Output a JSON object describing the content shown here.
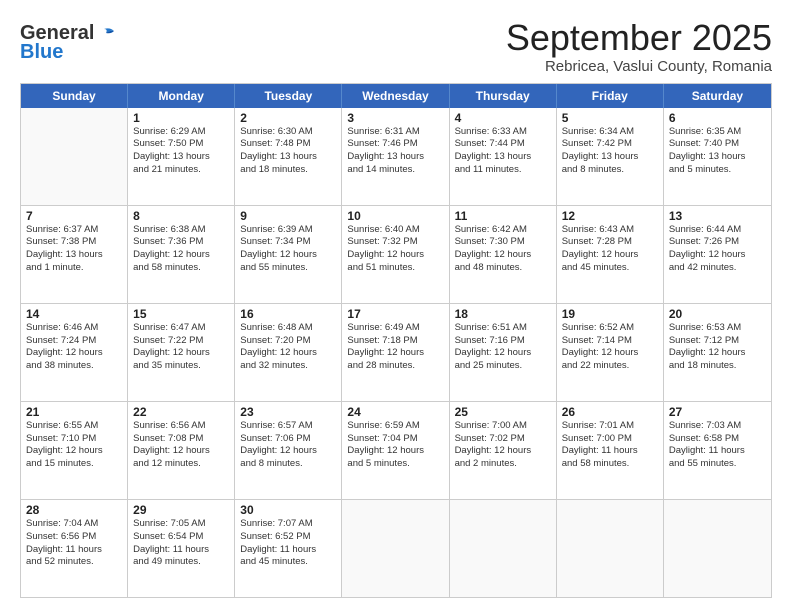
{
  "logo": {
    "general": "General",
    "blue": "Blue"
  },
  "title": "September 2025",
  "location": "Rebricea, Vaslui County, Romania",
  "header_days": [
    "Sunday",
    "Monday",
    "Tuesday",
    "Wednesday",
    "Thursday",
    "Friday",
    "Saturday"
  ],
  "rows": [
    [
      {
        "day": "",
        "lines": []
      },
      {
        "day": "1",
        "lines": [
          "Sunrise: 6:29 AM",
          "Sunset: 7:50 PM",
          "Daylight: 13 hours",
          "and 21 minutes."
        ]
      },
      {
        "day": "2",
        "lines": [
          "Sunrise: 6:30 AM",
          "Sunset: 7:48 PM",
          "Daylight: 13 hours",
          "and 18 minutes."
        ]
      },
      {
        "day": "3",
        "lines": [
          "Sunrise: 6:31 AM",
          "Sunset: 7:46 PM",
          "Daylight: 13 hours",
          "and 14 minutes."
        ]
      },
      {
        "day": "4",
        "lines": [
          "Sunrise: 6:33 AM",
          "Sunset: 7:44 PM",
          "Daylight: 13 hours",
          "and 11 minutes."
        ]
      },
      {
        "day": "5",
        "lines": [
          "Sunrise: 6:34 AM",
          "Sunset: 7:42 PM",
          "Daylight: 13 hours",
          "and 8 minutes."
        ]
      },
      {
        "day": "6",
        "lines": [
          "Sunrise: 6:35 AM",
          "Sunset: 7:40 PM",
          "Daylight: 13 hours",
          "and 5 minutes."
        ]
      }
    ],
    [
      {
        "day": "7",
        "lines": [
          "Sunrise: 6:37 AM",
          "Sunset: 7:38 PM",
          "Daylight: 13 hours",
          "and 1 minute."
        ]
      },
      {
        "day": "8",
        "lines": [
          "Sunrise: 6:38 AM",
          "Sunset: 7:36 PM",
          "Daylight: 12 hours",
          "and 58 minutes."
        ]
      },
      {
        "day": "9",
        "lines": [
          "Sunrise: 6:39 AM",
          "Sunset: 7:34 PM",
          "Daylight: 12 hours",
          "and 55 minutes."
        ]
      },
      {
        "day": "10",
        "lines": [
          "Sunrise: 6:40 AM",
          "Sunset: 7:32 PM",
          "Daylight: 12 hours",
          "and 51 minutes."
        ]
      },
      {
        "day": "11",
        "lines": [
          "Sunrise: 6:42 AM",
          "Sunset: 7:30 PM",
          "Daylight: 12 hours",
          "and 48 minutes."
        ]
      },
      {
        "day": "12",
        "lines": [
          "Sunrise: 6:43 AM",
          "Sunset: 7:28 PM",
          "Daylight: 12 hours",
          "and 45 minutes."
        ]
      },
      {
        "day": "13",
        "lines": [
          "Sunrise: 6:44 AM",
          "Sunset: 7:26 PM",
          "Daylight: 12 hours",
          "and 42 minutes."
        ]
      }
    ],
    [
      {
        "day": "14",
        "lines": [
          "Sunrise: 6:46 AM",
          "Sunset: 7:24 PM",
          "Daylight: 12 hours",
          "and 38 minutes."
        ]
      },
      {
        "day": "15",
        "lines": [
          "Sunrise: 6:47 AM",
          "Sunset: 7:22 PM",
          "Daylight: 12 hours",
          "and 35 minutes."
        ]
      },
      {
        "day": "16",
        "lines": [
          "Sunrise: 6:48 AM",
          "Sunset: 7:20 PM",
          "Daylight: 12 hours",
          "and 32 minutes."
        ]
      },
      {
        "day": "17",
        "lines": [
          "Sunrise: 6:49 AM",
          "Sunset: 7:18 PM",
          "Daylight: 12 hours",
          "and 28 minutes."
        ]
      },
      {
        "day": "18",
        "lines": [
          "Sunrise: 6:51 AM",
          "Sunset: 7:16 PM",
          "Daylight: 12 hours",
          "and 25 minutes."
        ]
      },
      {
        "day": "19",
        "lines": [
          "Sunrise: 6:52 AM",
          "Sunset: 7:14 PM",
          "Daylight: 12 hours",
          "and 22 minutes."
        ]
      },
      {
        "day": "20",
        "lines": [
          "Sunrise: 6:53 AM",
          "Sunset: 7:12 PM",
          "Daylight: 12 hours",
          "and 18 minutes."
        ]
      }
    ],
    [
      {
        "day": "21",
        "lines": [
          "Sunrise: 6:55 AM",
          "Sunset: 7:10 PM",
          "Daylight: 12 hours",
          "and 15 minutes."
        ]
      },
      {
        "day": "22",
        "lines": [
          "Sunrise: 6:56 AM",
          "Sunset: 7:08 PM",
          "Daylight: 12 hours",
          "and 12 minutes."
        ]
      },
      {
        "day": "23",
        "lines": [
          "Sunrise: 6:57 AM",
          "Sunset: 7:06 PM",
          "Daylight: 12 hours",
          "and 8 minutes."
        ]
      },
      {
        "day": "24",
        "lines": [
          "Sunrise: 6:59 AM",
          "Sunset: 7:04 PM",
          "Daylight: 12 hours",
          "and 5 minutes."
        ]
      },
      {
        "day": "25",
        "lines": [
          "Sunrise: 7:00 AM",
          "Sunset: 7:02 PM",
          "Daylight: 12 hours",
          "and 2 minutes."
        ]
      },
      {
        "day": "26",
        "lines": [
          "Sunrise: 7:01 AM",
          "Sunset: 7:00 PM",
          "Daylight: 11 hours",
          "and 58 minutes."
        ]
      },
      {
        "day": "27",
        "lines": [
          "Sunrise: 7:03 AM",
          "Sunset: 6:58 PM",
          "Daylight: 11 hours",
          "and 55 minutes."
        ]
      }
    ],
    [
      {
        "day": "28",
        "lines": [
          "Sunrise: 7:04 AM",
          "Sunset: 6:56 PM",
          "Daylight: 11 hours",
          "and 52 minutes."
        ]
      },
      {
        "day": "29",
        "lines": [
          "Sunrise: 7:05 AM",
          "Sunset: 6:54 PM",
          "Daylight: 11 hours",
          "and 49 minutes."
        ]
      },
      {
        "day": "30",
        "lines": [
          "Sunrise: 7:07 AM",
          "Sunset: 6:52 PM",
          "Daylight: 11 hours",
          "and 45 minutes."
        ]
      },
      {
        "day": "",
        "lines": []
      },
      {
        "day": "",
        "lines": []
      },
      {
        "day": "",
        "lines": []
      },
      {
        "day": "",
        "lines": []
      }
    ]
  ]
}
